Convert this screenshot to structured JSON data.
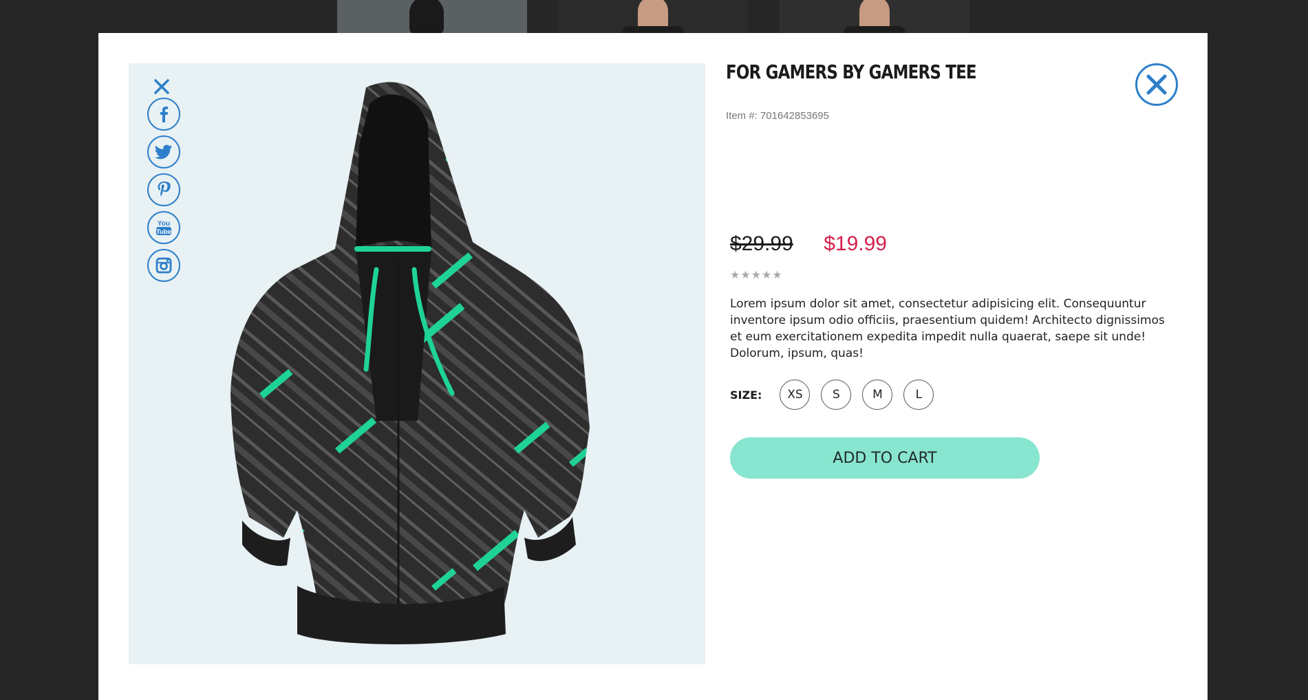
{
  "colors": {
    "accent": "#2e7fca",
    "sale_price": "#d41f4c",
    "cart_button": "#88e5cf",
    "overlay": "#262626",
    "image_bg": "#e8f1f3"
  },
  "share": {
    "close_icon": "close-icon",
    "items": [
      {
        "icon": "facebook-icon"
      },
      {
        "icon": "twitter-icon"
      },
      {
        "icon": "pinterest-icon"
      },
      {
        "icon": "youtube-icon",
        "label_top": "You",
        "label_bottom": "Tube"
      },
      {
        "icon": "instagram-icon"
      }
    ]
  },
  "product": {
    "title": "FOR GAMERS BY GAMERS TEE",
    "item_label": "Item #:",
    "item_number": "701642853695",
    "old_price": "$29.99",
    "new_price": "$19.99",
    "rating_stars": "★★★★★",
    "rating": 0,
    "description": "Lorem ipsum dolor sit amet, consectetur adipisicing elit. Consequuntur inventore ipsum odio officiis, praesentium quidem! Architecto dignissimos et eum exercitationem expedita impedit nulla quaerat, saepe sit unde! Dolorum, ipsum, quas!",
    "size_label": "SIZE:",
    "sizes": [
      "XS",
      "S",
      "M",
      "L"
    ],
    "add_to_cart": "ADD TO CART"
  },
  "modal_close_icon": "close-circle-icon"
}
